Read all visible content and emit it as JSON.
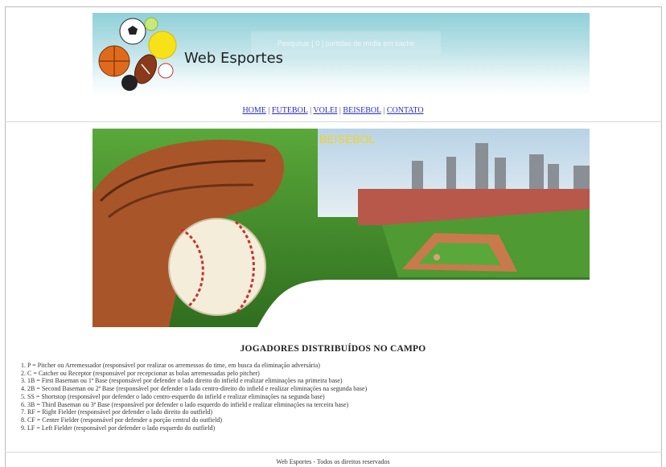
{
  "header": {
    "site_name": "Web Esportes",
    "ghost_text": "Pesquisar [ 0 ] partidas de mídia em cache"
  },
  "nav": {
    "items": [
      {
        "label": "HOME"
      },
      {
        "label": "FUTEBOL"
      },
      {
        "label": "VOLEI"
      },
      {
        "label": "BEISEBOL"
      },
      {
        "label": "CONTATO"
      }
    ],
    "separator": "|"
  },
  "banner": {
    "label": "BEISEBOL",
    "colors": {
      "label": "#f7d21a",
      "grass": "#3f8f2a",
      "sky": "#cfe1ee"
    }
  },
  "main": {
    "heading": "JOGADORES DISTRIBUÍDOS NO CAMPO",
    "players": [
      "1. P = Pitcher ou Arremessador (responsável por realizar os arremessos do time, em busca da eliminação adversária)",
      "2. C = Catcher ou Receptor (responsável por recepcionar as bolas arremessadas pelo pitcher)",
      "3. 1B = First Baseman ou 1ª Base (responsável por defender o lado direito do infield e realizar eliminações na primeira base)",
      "4. 2B = Second Baseman ou 2ª Base (responsável por defender o lado centro-direito do infield e realizar eliminações na segunda base)",
      "5. SS = Shortstop (responsável por defender o lado centro-esquerdo do infield e realizar eliminações na segunda base)",
      "6. 3B = Third Baseman ou 3ª Base (responsável por defender o lado esquerdo do infield e realizar eliminações na terceira base)",
      "7. RF = Right Fielder (responsável por defender o lado direito do outfield)",
      "8. CF = Center Fielder (responsável por defender a porção central do outfield)",
      "9. LF = Left Fielder (responsável por defender o lado esquerdo do outfield)"
    ]
  },
  "footer": {
    "text": "Web Esportes - Todos os direitos reservados"
  }
}
